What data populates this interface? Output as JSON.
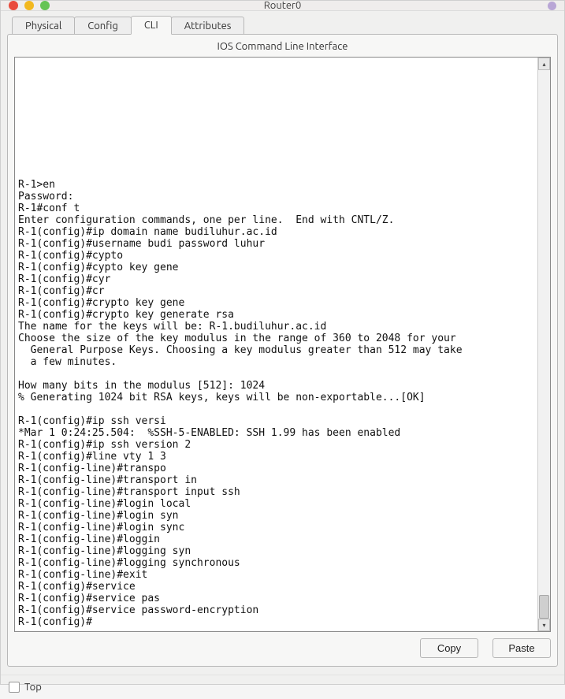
{
  "window": {
    "title": "Router0"
  },
  "tabs": {
    "t0": "Physical",
    "t1": "Config",
    "t2": "CLI",
    "t3": "Attributes",
    "active_index": 2
  },
  "panel": {
    "title": "IOS Command Line Interface"
  },
  "buttons": {
    "copy": "Copy",
    "paste": "Paste"
  },
  "footer": {
    "top_label": "Top",
    "top_checked": false
  },
  "console_text": "\n\n\n\n\n\n\n\n\n\nR-1>en\nPassword:\nR-1#conf t\nEnter configuration commands, one per line.  End with CNTL/Z.\nR-1(config)#ip domain name budiluhur.ac.id\nR-1(config)#username budi password luhur\nR-1(config)#cypto\nR-1(config)#cypto key gene\nR-1(config)#cyr\nR-1(config)#cr\nR-1(config)#crypto key gene\nR-1(config)#crypto key generate rsa\nThe name for the keys will be: R-1.budiluhur.ac.id\nChoose the size of the key modulus in the range of 360 to 2048 for your\n  General Purpose Keys. Choosing a key modulus greater than 512 may take\n  a few minutes.\n\nHow many bits in the modulus [512]: 1024\n% Generating 1024 bit RSA keys, keys will be non-exportable...[OK]\n\nR-1(config)#ip ssh versi\n*Mar 1 0:24:25.504:  %SSH-5-ENABLED: SSH 1.99 has been enabled\nR-1(config)#ip ssh version 2\nR-1(config)#line vty 1 3\nR-1(config-line)#transpo\nR-1(config-line)#transport in\nR-1(config-line)#transport input ssh\nR-1(config-line)#login local\nR-1(config-line)#login syn\nR-1(config-line)#login sync\nR-1(config-line)#loggin\nR-1(config-line)#logging syn\nR-1(config-line)#logging synchronous\nR-1(config-line)#exit\nR-1(config)#service\nR-1(config)#service pas\nR-1(config)#service password-encryption\nR-1(config)#"
}
